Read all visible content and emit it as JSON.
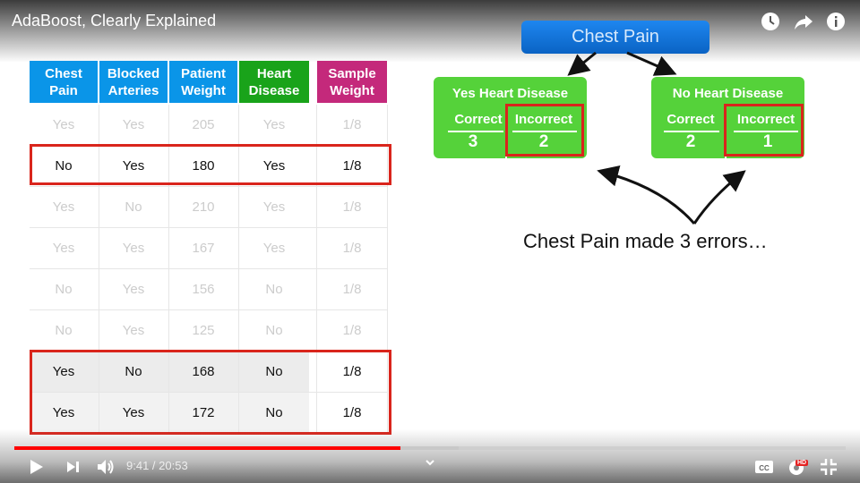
{
  "video": {
    "title": "AdaBoost, Clearly Explained"
  },
  "table": {
    "headers": [
      {
        "label": "Chest\nPain",
        "color": "#0a95e8"
      },
      {
        "label": "Blocked\nArteries",
        "color": "#0a95e8"
      },
      {
        "label": "Patient\nWeight",
        "color": "#0a95e8"
      },
      {
        "label": "Heart\nDisease",
        "color": "#19a31a"
      },
      {
        "label": "Sample\nWeight",
        "color": "#c4297b"
      }
    ],
    "rows": [
      {
        "cells": [
          "Yes",
          "Yes",
          "205",
          "Yes",
          "1/8"
        ],
        "highlight": false
      },
      {
        "cells": [
          "No",
          "Yes",
          "180",
          "Yes",
          "1/8"
        ],
        "highlight": true
      },
      {
        "cells": [
          "Yes",
          "No",
          "210",
          "Yes",
          "1/8"
        ],
        "highlight": false
      },
      {
        "cells": [
          "Yes",
          "Yes",
          "167",
          "Yes",
          "1/8"
        ],
        "highlight": false
      },
      {
        "cells": [
          "No",
          "Yes",
          "156",
          "No",
          "1/8"
        ],
        "highlight": false
      },
      {
        "cells": [
          "No",
          "Yes",
          "125",
          "No",
          "1/8"
        ],
        "highlight": false
      },
      {
        "cells": [
          "Yes",
          "No",
          "168",
          "No",
          "1/8"
        ],
        "highlight": true
      },
      {
        "cells": [
          "Yes",
          "Yes",
          "172",
          "No",
          "1/8"
        ],
        "highlight": true
      }
    ]
  },
  "tree": {
    "root": "Chest Pain",
    "leaves": [
      {
        "title": "Yes Heart Disease",
        "correct_label": "Correct",
        "incorrect_label": "Incorrect",
        "correct": "3",
        "incorrect": "2"
      },
      {
        "title": "No Heart Disease",
        "correct_label": "Correct",
        "incorrect_label": "Incorrect",
        "correct": "2",
        "incorrect": "1"
      }
    ],
    "annotation": "Chest Pain made 3 errors…"
  },
  "player": {
    "current_time": "9:41",
    "duration": "20:53",
    "separator": " / ",
    "progress_fraction": 0.464,
    "buffer_fraction": 0.534,
    "hd_badge": "HD",
    "icons": [
      "watch-later-icon",
      "share-icon",
      "info-icon",
      "play-icon",
      "next-icon",
      "volume-icon",
      "chevron-down-icon",
      "captions-icon",
      "settings-icon",
      "exit-fullscreen-icon"
    ]
  }
}
